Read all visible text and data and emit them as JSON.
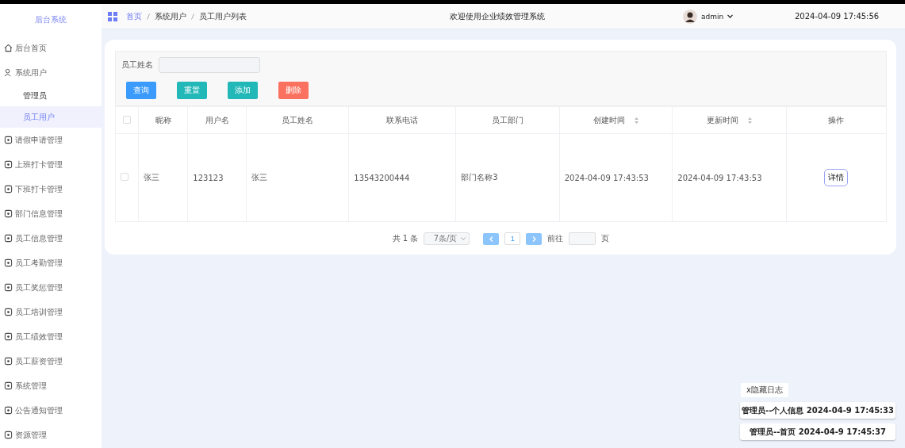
{
  "sidebar": {
    "title": "后台系统",
    "items": [
      {
        "label": "后台首页"
      },
      {
        "label": "系统用户",
        "children": [
          {
            "label": "管理员",
            "selected": false
          },
          {
            "label": "员工用户",
            "selected": true
          }
        ]
      },
      {
        "label": "请假申请管理"
      },
      {
        "label": "上班打卡管理"
      },
      {
        "label": "下班打卡管理"
      },
      {
        "label": "部门信息管理"
      },
      {
        "label": "员工信息管理"
      },
      {
        "label": "员工考勤管理"
      },
      {
        "label": "员工奖惩管理"
      },
      {
        "label": "员工培训管理"
      },
      {
        "label": "员工绩效管理"
      },
      {
        "label": "员工薪资管理"
      },
      {
        "label": "系统管理"
      },
      {
        "label": "公告通知管理"
      },
      {
        "label": "资源管理"
      }
    ]
  },
  "header": {
    "breadcrumb": [
      "首页",
      "系统用户",
      "员工用户列表"
    ],
    "title": "欢迎使用企业绩效管理系统",
    "user": "admin",
    "datetime": "2024-04-09 17:45:56"
  },
  "search": {
    "label": "员工姓名",
    "buttons": [
      {
        "label": "查询",
        "kind": "primary"
      },
      {
        "label": "重置",
        "kind": "teal"
      },
      {
        "label": "添加",
        "kind": "teal"
      },
      {
        "label": "删除",
        "kind": "danger"
      }
    ]
  },
  "table": {
    "select_all_checked": false,
    "columns": [
      {
        "label": "昵称",
        "sortable": false
      },
      {
        "label": "用户名",
        "sortable": false
      },
      {
        "label": "员工姓名",
        "sortable": false
      },
      {
        "label": "联系电话",
        "sortable": false
      },
      {
        "label": "员工部门",
        "sortable": false
      },
      {
        "label": "创建时间",
        "sortable": true
      },
      {
        "label": "更新时间",
        "sortable": true
      },
      {
        "label": "操作",
        "sortable": false
      }
    ],
    "rows": [
      {
        "checked": false,
        "cells": [
          "张三",
          "123123",
          "张三",
          "13543200444",
          "部门名称3",
          "2024-04-09 17:43:53",
          "2024-04-09 17:43:53"
        ],
        "action": "详情"
      }
    ]
  },
  "pagination": {
    "total": "共 1 条",
    "page_size": "7条/页",
    "pages": [
      {
        "label": "1",
        "selected": true
      }
    ],
    "goto_label": "前往",
    "goto_suffix": "页"
  },
  "log": {
    "toggle": "x隐藏日志",
    "entries": [
      "管理员--个人信息 2024-04-9 17:45:33",
      "管理员--首页 2024-04-9 17:45:37"
    ]
  }
}
